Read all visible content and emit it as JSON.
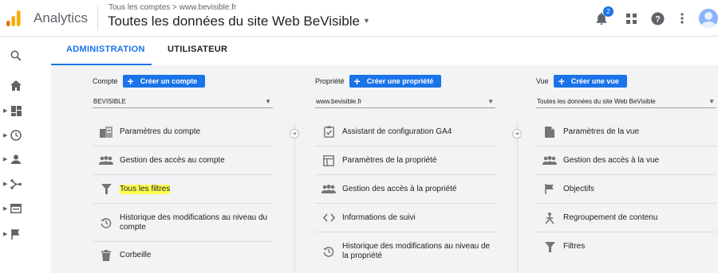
{
  "header": {
    "app_name": "Analytics",
    "breadcrumb": "Tous les comptes > www.bevisible.fr",
    "site_title": "Toutes les données du site Web BeVisible",
    "notification_count": "2",
    "icons": [
      "bell-icon",
      "apps-grid-icon",
      "help-icon",
      "more-vert-icon",
      "avatar"
    ]
  },
  "tabs": [
    {
      "label": "ADMINISTRATION",
      "active": true
    },
    {
      "label": "UTILISATEUR",
      "active": false
    }
  ],
  "rail": {
    "icons": [
      "search-icon",
      "home-icon",
      "dashboard-icon",
      "clock-icon",
      "person-icon",
      "acquisition-icon",
      "behavior-icon",
      "flag-icon"
    ]
  },
  "account": {
    "label": "Compte",
    "create_button": "Créer un compte",
    "selected": "BEVISIBLE",
    "items": [
      {
        "label": "Paramètres du compte",
        "icon": "building-icon"
      },
      {
        "label": "Gestion des accès au compte",
        "icon": "people-icon"
      },
      {
        "label": "Tous les filtres",
        "icon": "filter-icon",
        "highlighted": true
      },
      {
        "label": "Historique des modifications au niveau du compte",
        "icon": "history-icon"
      },
      {
        "label": "Corbeille",
        "icon": "trash-icon"
      }
    ]
  },
  "property": {
    "label": "Propriété",
    "create_button": "Créer une propriété",
    "selected": "www.bevisible.fr",
    "items": [
      {
        "label": "Assistant de configuration GA4",
        "icon": "clipboard-check-icon"
      },
      {
        "label": "Paramètres de la propriété",
        "icon": "property-settings-icon"
      },
      {
        "label": "Gestion des accès à la propriété",
        "icon": "people-icon"
      },
      {
        "label": "Informations de suivi",
        "icon": "code-icon"
      },
      {
        "label": "Historique des modifications au niveau de la propriété",
        "icon": "history-icon"
      }
    ]
  },
  "view": {
    "label": "Vue",
    "create_button": "Créer une vue",
    "selected": "Toutes les données du site Web BeVisible",
    "items": [
      {
        "label": "Paramètres de la vue",
        "icon": "document-icon"
      },
      {
        "label": "Gestion des accès à la vue",
        "icon": "people-icon"
      },
      {
        "label": "Objectifs",
        "icon": "flag-icon"
      },
      {
        "label": "Regroupement de contenu",
        "icon": "content-grouping-icon"
      },
      {
        "label": "Filtres",
        "icon": "filter-icon"
      }
    ]
  },
  "colors": {
    "accent": "#1a73e8",
    "highlight": "#ffff52",
    "logo_orange": "#f9ab00",
    "logo_dark_orange": "#e37400"
  }
}
